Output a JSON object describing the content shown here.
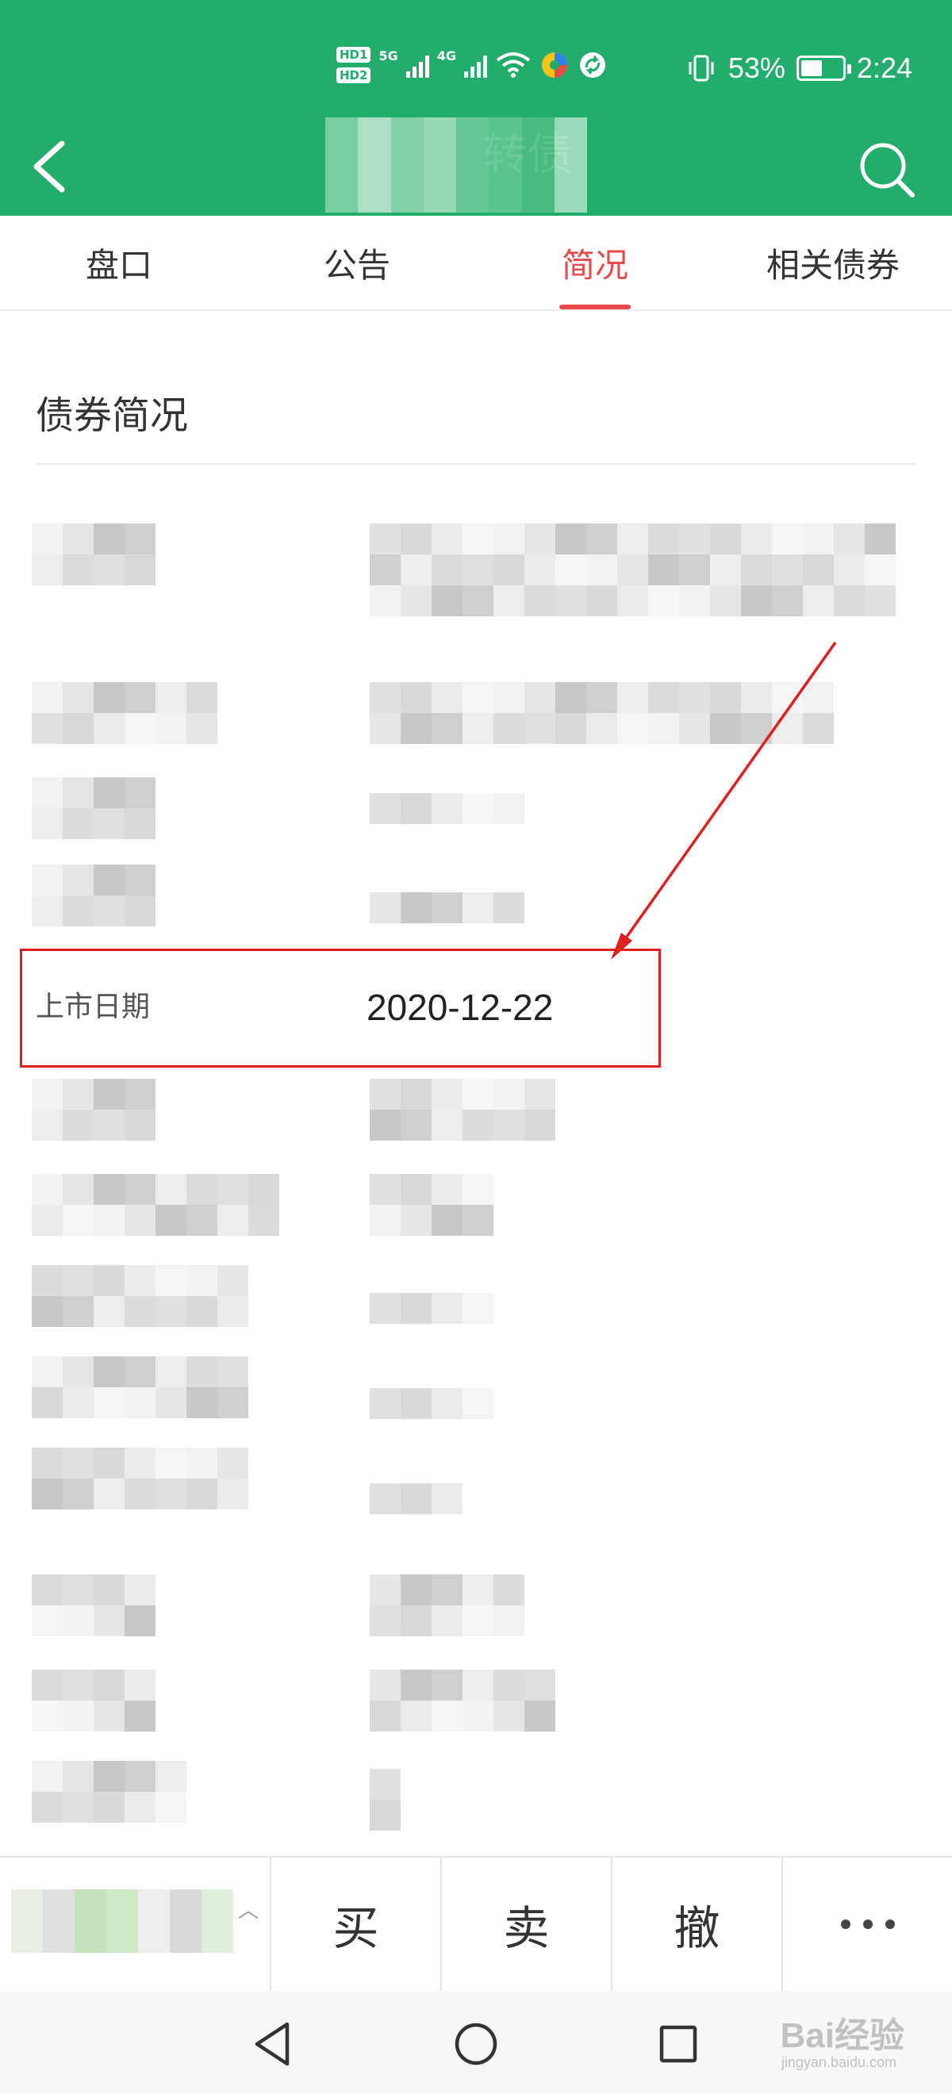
{
  "status_bar": {
    "hd1": "HD1",
    "hd2": "HD2",
    "net1": "5G",
    "net2": "4G",
    "battery_text": "53%",
    "battery_level": 0.53,
    "time": "2:24"
  },
  "header": {
    "title": "转债",
    "back_icon": "chevron-left-icon",
    "search_icon": "search-icon"
  },
  "tabs": [
    {
      "label": "盘口",
      "active": false
    },
    {
      "label": "公告",
      "active": false
    },
    {
      "label": "简况",
      "active": true
    },
    {
      "label": "相关债券",
      "active": false
    }
  ],
  "section": {
    "title": "债券简况"
  },
  "highlighted_field": {
    "label": "上市日期",
    "value": "2020-12-22"
  },
  "trade_bar": {
    "buy": "买",
    "sell": "卖",
    "cancel": "撤",
    "more_icon": "more-dots-icon",
    "expand_icon": "chevron-up-icon"
  },
  "system_nav": {
    "back_icon": "nav-back-icon",
    "home_icon": "nav-home-icon",
    "recents_icon": "nav-recents-icon"
  },
  "watermark": {
    "brand": "Bai经验",
    "url": "jingyan.baidu.com"
  },
  "colors": {
    "header_green": "#23ad6c",
    "active_tab_red": "#e84a4a",
    "highlight_red": "#e02020"
  }
}
